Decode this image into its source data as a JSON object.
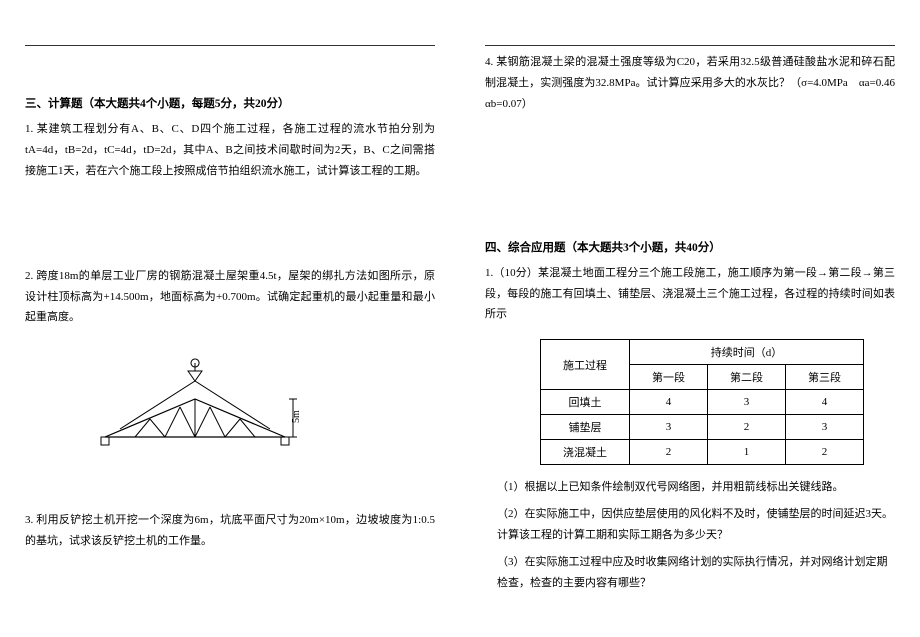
{
  "left": {
    "section3_heading": "三、计算题（本大题共4个小题，每题5分，共20分）",
    "q1": "1. 某建筑工程划分有A、B、C、D四个施工过程，各施工过程的流水节拍分别为tA=4d，tB=2d，tC=4d，tD=2d，其中A、B之间技术间歇时间为2天，B、C之间需搭接施工1天，若在六个施工段上按照成倍节拍组织流水施工，试计算该工程的工期。",
    "q2": "2. 跨度18m的单层工业厂房的钢筋混凝土屋架重4.5t，屋架的绑扎方法如图所示，原设计柱顶标高为+14.500m，地面标高为+0.700m。试确定起重机的最小起重量和最小起重高度。",
    "fig_label": "5m",
    "q3": "3. 利用反铲挖土机开挖一个深度为6m，坑底平面尺寸为20m×10m，边坡坡度为1:0.5的基坑，试求该反铲挖土机的工作量。"
  },
  "right": {
    "q4_line1": "4. 某钢筋混凝土梁的混凝土强度等级为C20，若采用32.5级普通硅酸盐水泥和碎石配制混凝土，实测强度为32.8MPa。试计算应采用多大的水灰比？（σ=4.0MPa　αa=0.46　αb=0.07）",
    "section4_heading": "四、综合应用题（本大题共3个小题，共40分）",
    "q1_intro": "1.（10分）某混凝土地面工程分三个施工段施工，施工顺序为第一段→第二段→第三段，每段的施工有回填土、铺垫层、浇混凝土三个施工过程，各过程的持续时间如表所示",
    "tbl": {
      "h_proc": "施工过程",
      "h_dur": "持续时间（d）",
      "h_c1": "第一段",
      "h_c2": "第二段",
      "h_c3": "第三段",
      "r1_name": "回填土",
      "r1c1": "4",
      "r1c2": "3",
      "r1c3": "4",
      "r2_name": "铺垫层",
      "r2c1": "3",
      "r2c2": "2",
      "r2c3": "3",
      "r3_name": "浇混凝土",
      "r3c1": "2",
      "r3c2": "1",
      "r3c3": "2"
    },
    "sub1": "（1）根据以上已知条件绘制双代号网络图，并用粗箭线标出关键线路。",
    "sub2": "（2）在实际施工中，因供应垫层使用的风化料不及时，使铺垫层的时间延迟3天。计算该工程的计算工期和实际工期各为多少天？",
    "sub3": "（3）在实际施工过程中应及时收集网络计划的实际执行情况，并对网络计划定期检查，检查的主要内容有哪些？"
  },
  "chart_data": {
    "type": "table",
    "title": "持续时间（d）",
    "categories": [
      "第一段",
      "第二段",
      "第三段"
    ],
    "series": [
      {
        "name": "回填土",
        "values": [
          4,
          3,
          4
        ]
      },
      {
        "name": "铺垫层",
        "values": [
          3,
          2,
          3
        ]
      },
      {
        "name": "浇混凝土",
        "values": [
          2,
          1,
          2
        ]
      }
    ]
  }
}
